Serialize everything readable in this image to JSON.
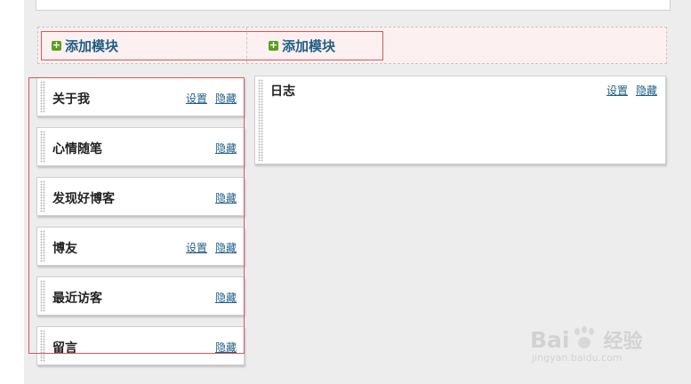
{
  "add_zone": {
    "buttons": [
      {
        "label": "添加模块"
      },
      {
        "label": "添加模块"
      }
    ]
  },
  "left_modules": [
    {
      "title": "关于我",
      "setting": "设置",
      "hide": "隐藏"
    },
    {
      "title": "心情随笔",
      "hide": "隐藏"
    },
    {
      "title": "发现好博客",
      "hide": "隐藏"
    },
    {
      "title": "博友",
      "setting": "设置",
      "hide": "隐藏"
    },
    {
      "title": "最近访客",
      "hide": "隐藏"
    },
    {
      "title": "留言",
      "hide": "隐藏"
    }
  ],
  "right_module": {
    "title": "日志",
    "setting": "设置",
    "hide": "隐藏"
  },
  "watermark": {
    "logo_text": "Bai",
    "logo_text2": "经验",
    "url": "jingyan.baidu.com"
  },
  "colors": {
    "link": "#1f5e86",
    "plus_icon": "#59a11e",
    "highlight_border": "#cf5a5a",
    "add_zone_bg": "#fdf0f0"
  }
}
